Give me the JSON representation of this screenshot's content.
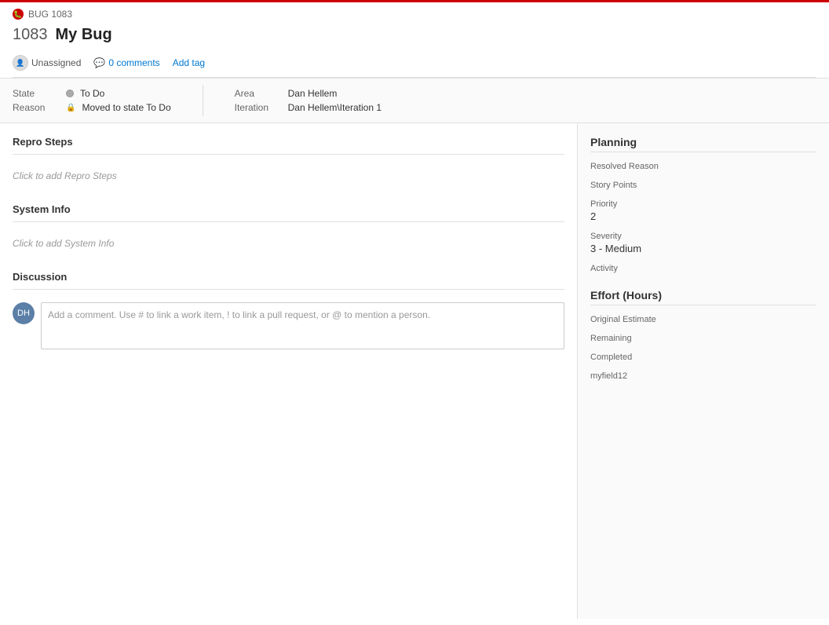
{
  "titleBar": {
    "bugLabel": "BUG 1083",
    "workItemId": "1083",
    "workItemTitle": "My Bug"
  },
  "metaBar": {
    "assignee": "Unassigned",
    "commentsCount": "0 comments",
    "addTag": "Add tag"
  },
  "fields": {
    "stateLabel": "State",
    "stateValue": "To Do",
    "reasonLabel": "Reason",
    "reasonValue": "Moved to state To Do",
    "areaLabel": "Area",
    "areaValue": "Dan Hellem",
    "iterationLabel": "Iteration",
    "iterationValue": "Dan Hellem\\Iteration 1"
  },
  "sections": {
    "reproSteps": {
      "title": "Repro Steps",
      "placeholder": "Click to add Repro Steps"
    },
    "systemInfo": {
      "title": "System Info",
      "placeholder": "Click to add System Info"
    },
    "discussion": {
      "title": "Discussion",
      "commentPlaceholder": "Add a comment. Use # to link a work item, ! to link a pull request, or @ to mention a person."
    }
  },
  "planning": {
    "title": "Planning",
    "fields": {
      "resolvedReasonLabel": "Resolved Reason",
      "resolvedReasonValue": "",
      "storyPointsLabel": "Story Points",
      "storyPointsValue": "",
      "priorityLabel": "Priority",
      "priorityValue": "2",
      "severityLabel": "Severity",
      "severityValue": "3 - Medium",
      "activityLabel": "Activity",
      "activityValue": ""
    }
  },
  "effort": {
    "title": "Effort (Hours)",
    "fields": {
      "originalEstimateLabel": "Original Estimate",
      "originalEstimateValue": "",
      "remainingLabel": "Remaining",
      "remainingValue": "",
      "completedLabel": "Completed",
      "completedValue": "",
      "myfield12Label": "myfield12",
      "myfield12Value": ""
    }
  },
  "icons": {
    "bug": "🐛",
    "comment": "💬",
    "lock": "🔒"
  }
}
